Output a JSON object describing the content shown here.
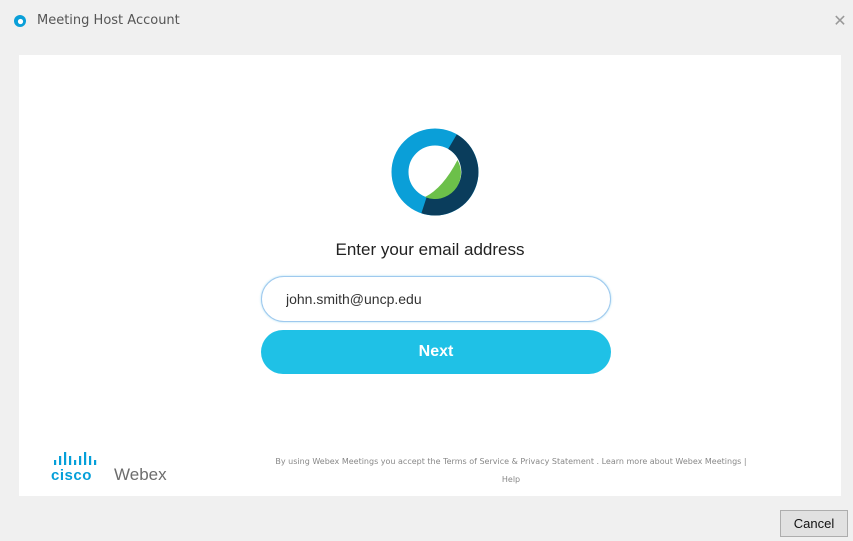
{
  "window": {
    "title": "Meeting Host Account",
    "close_icon": "close-icon",
    "app_icon": "webex-icon"
  },
  "main": {
    "logo_icon": "webex-logo",
    "prompt": "Enter your email address",
    "email_value": "john.smith@uncp.edu",
    "next_label": "Next"
  },
  "footer": {
    "cisco_text": "cisco",
    "webex_text": "Webex",
    "legal_text": "By using Webex Meetings you accept the",
    "terms_link": "Terms of Service",
    "amp": "&",
    "privacy_link": "Privacy Statement",
    "sep1": ".",
    "learn_more_link": "Learn more about Webex Meetings",
    "sep2": "|",
    "help_link": "Help"
  },
  "actions": {
    "cancel_label": "Cancel"
  },
  "colors": {
    "accent": "#1fc1e6",
    "logo_blue": "#0a9fd8",
    "logo_navy": "#0a3d5c",
    "logo_green": "#6cc04a",
    "cisco_blue": "#049fd9"
  }
}
